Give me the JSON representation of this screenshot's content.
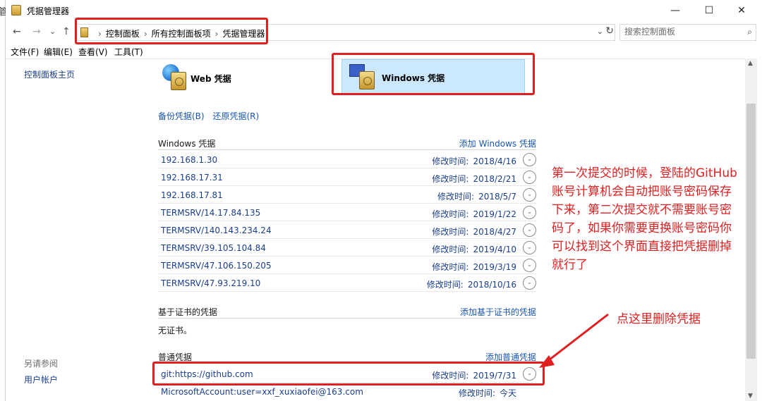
{
  "window": {
    "title": "凭据管理器",
    "minimize": "—",
    "maximize": "☐",
    "close": "✕"
  },
  "nav": {
    "back": "←",
    "forward": "→",
    "recent": "⌄",
    "up": "↑",
    "breadcrumb": [
      "控制面板",
      "所有控制面板项",
      "凭据管理器"
    ],
    "separator": "›",
    "dropdown": "⌄",
    "refresh": "↻",
    "search_placeholder": "搜索控制面板",
    "search_icon": "⌕"
  },
  "menu": [
    "文件(F)",
    "编辑(E)",
    "查看(V)",
    "工具(T)"
  ],
  "sidebar": {
    "home": "控制面板主页",
    "see_also": "另请参阅",
    "user_accounts": "用户帐户"
  },
  "tabs": {
    "web": "Web 凭据",
    "windows": "Windows 凭据",
    "selected": "windows"
  },
  "actions": {
    "backup": "备份凭据(B)",
    "restore": "还原凭据(R)"
  },
  "sections": {
    "windows": {
      "title": "Windows 凭据",
      "add": "添加 Windows 凭据",
      "items": [
        {
          "name": "192.168.1.30",
          "modified_label": "修改时间:",
          "date": "2018/4/16"
        },
        {
          "name": "192.168.17.31",
          "modified_label": "修改时间:",
          "date": "2018/2/21"
        },
        {
          "name": "192.168.17.81",
          "modified_label": "修改时间:",
          "date": "2018/5/7"
        },
        {
          "name": "TERMSRV/14.17.84.135",
          "modified_label": "修改时间:",
          "date": "2019/1/22"
        },
        {
          "name": "TERMSRV/140.143.234.24",
          "modified_label": "修改时间:",
          "date": "2018/4/27"
        },
        {
          "name": "TERMSRV/39.105.104.84",
          "modified_label": "修改时间:",
          "date": "2019/4/10"
        },
        {
          "name": "TERMSRV/47.106.150.205",
          "modified_label": "修改时间:",
          "date": "2019/3/19"
        },
        {
          "name": "TERMSRV/47.93.219.10",
          "modified_label": "修改时间:",
          "date": "2018/10/16"
        }
      ]
    },
    "certificate": {
      "title": "基于证书的凭据",
      "add": "添加基于证书的凭据",
      "empty": "无证书。"
    },
    "generic": {
      "title": "普通凭据",
      "add": "添加普通凭据",
      "items": [
        {
          "name": "git:https://github.com",
          "modified_label": "修改时间:",
          "date": "2019/7/31"
        },
        {
          "name": "MicrosoftAccount:user=xxf_xuxiaofei@163.com",
          "modified_label": "修改时间:",
          "date": "今天"
        }
      ]
    }
  },
  "expand_glyph": "⌄",
  "annotations": {
    "main": "第一次提交的时候，登陆的GitHub账号计算机会自动把账号密码保存下来，第二次提交就不需要账号密码了，如果你需要更换账号密码你可以找到这个界面直接把凭据删掉就行了",
    "delete_hint": "点这里删除凭据",
    "color": "#e02020"
  },
  "scroll": {
    "up": "▲",
    "down": "▼"
  }
}
